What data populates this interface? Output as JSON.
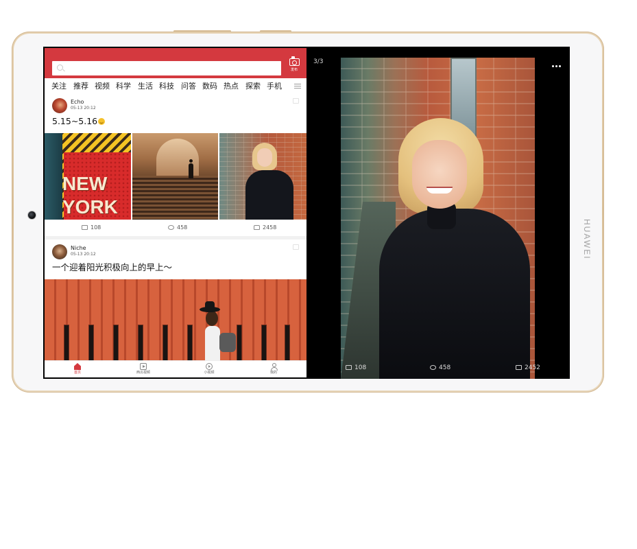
{
  "device": {
    "brand": "HUAWEI"
  },
  "header": {
    "publish_label": "发布",
    "search_placeholder": ""
  },
  "channels": [
    "关注",
    "推荐",
    "视频",
    "科学",
    "生活",
    "科技",
    "问答",
    "数码",
    "热点",
    "探索",
    "手机"
  ],
  "feed": {
    "posts": [
      {
        "author": "Echo",
        "time": "05-13 20:12",
        "text": "5.15~5.16",
        "stats": {
          "comments": "108",
          "replies": "458",
          "likes": "2458"
        }
      },
      {
        "author": "Niche",
        "time": "05-13 20:12",
        "text": "一个迎着阳光积极向上的早上～"
      }
    ],
    "ny_text": {
      "line1": "NEW",
      "line2": "YORK"
    }
  },
  "tabbar": {
    "items": [
      {
        "label": "首页",
        "icon": "home-icon",
        "active": true
      },
      {
        "label": "西瓜视频",
        "icon": "play-icon",
        "active": false
      },
      {
        "label": "小视频",
        "icon": "short-video-icon",
        "active": false
      },
      {
        "label": "我的",
        "icon": "user-icon",
        "active": false
      }
    ]
  },
  "viewer": {
    "counter": "3/3",
    "stats": {
      "comments": "108",
      "replies": "458",
      "likes": "2452"
    }
  },
  "colors": {
    "accent": "#d4393f",
    "frame": "#d9bf98"
  }
}
